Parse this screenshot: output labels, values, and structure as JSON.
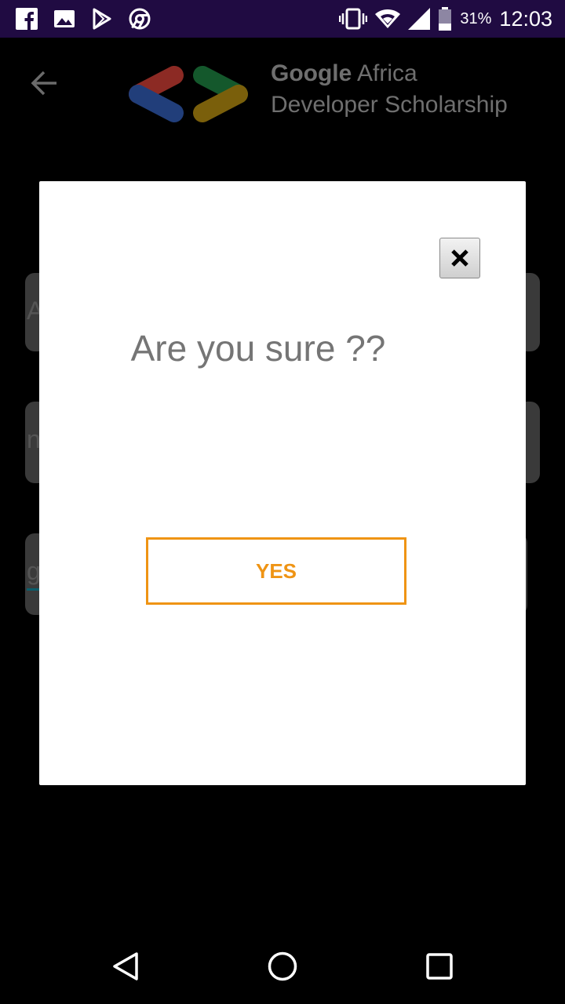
{
  "status_bar": {
    "battery_percent": "31%",
    "time": "12:03",
    "left_icons": [
      "facebook-icon",
      "gallery-icon",
      "play-store-icon",
      "chrome-icon"
    ],
    "right_icons": [
      "vibrate-icon",
      "wifi-icon",
      "signal-icon",
      "battery-icon"
    ]
  },
  "header": {
    "brand_line1_strong": "Google",
    "brand_line1_rest": " Africa",
    "brand_line2": "Developer Scholarship"
  },
  "background_fields": [
    {
      "visible_text": "A"
    },
    {
      "visible_text": "n"
    },
    {
      "visible_text": "gi"
    }
  ],
  "dialog": {
    "title": "Are you sure ??",
    "confirm_label": "YES",
    "close_icon": "close-icon",
    "accent_color": "#ef9414"
  },
  "nav_bar": {
    "icons": [
      "nav-back-icon",
      "nav-home-icon",
      "nav-recent-icon"
    ]
  }
}
